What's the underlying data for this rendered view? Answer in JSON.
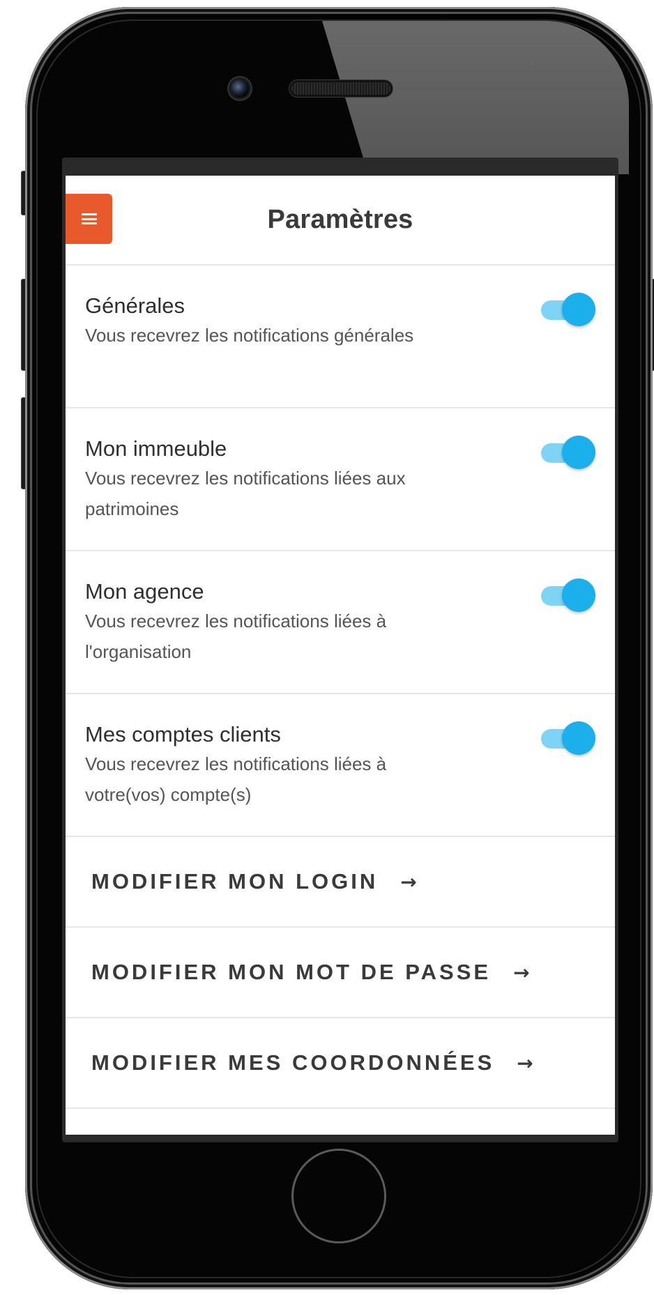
{
  "header": {
    "title": "Paramètres",
    "menu_icon": "hamburger-menu-icon"
  },
  "settings": [
    {
      "title": "Générales",
      "description": "Vous recevrez les notifications générales",
      "enabled": true
    },
    {
      "title": "Mon immeuble",
      "description": "Vous recevrez les notifications liées aux patrimoines",
      "enabled": true
    },
    {
      "title": "Mon agence",
      "description": "Vous recevrez les notifications liées à l'organisation",
      "enabled": true
    },
    {
      "title": "Mes comptes clients",
      "description": "Vous recevrez les notifications liées à votre(vos) compte(s)",
      "enabled": true
    }
  ],
  "actions": [
    {
      "label": "MODIFIER MON LOGIN",
      "arrow": "→"
    },
    {
      "label": "MODIFIER MON MOT DE PASSE",
      "arrow": "→"
    },
    {
      "label": "MODIFIER MES COORDONNÉES",
      "arrow": "→"
    }
  ],
  "colors": {
    "accent": "#e8592b",
    "toggle_on": "#1bb0ec",
    "toggle_track": "#7fd4f5"
  }
}
